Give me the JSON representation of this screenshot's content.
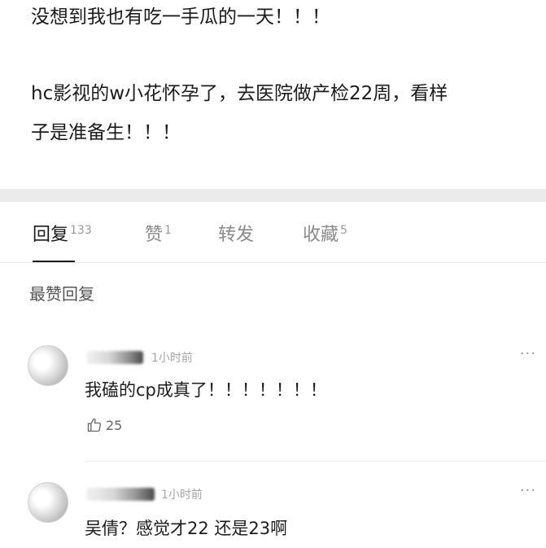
{
  "post": {
    "line1": "没想到我也有吃一手瓜的一天！！！",
    "line2": "hc影视的w小花怀孕了，去医院做产检22周，看样",
    "line3": "子是准备生！！！"
  },
  "tabs": [
    {
      "label": "回复",
      "count": "133"
    },
    {
      "label": "赞",
      "count": "1"
    },
    {
      "label": "转发",
      "count": ""
    },
    {
      "label": "收藏",
      "count": "5"
    }
  ],
  "section_title": "最赞回复",
  "comments": [
    {
      "time": "1小时前",
      "text": "我磕的cp成真了！！！！！！！",
      "likes": "25",
      "more": "···"
    },
    {
      "time": "1小时前",
      "text": "吴倩？感觉才22 还是23啊",
      "more": "···"
    }
  ],
  "icons": {
    "like": "thumbs-up-icon",
    "more": "more-dots-icon"
  }
}
